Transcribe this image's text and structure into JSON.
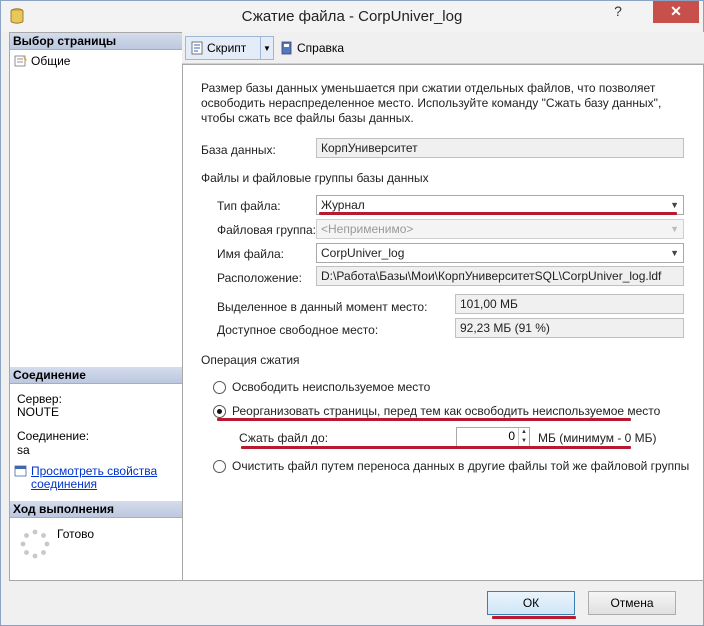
{
  "window": {
    "title": "Сжатие файла - CorpUniver_log",
    "help_label": "?",
    "close_label": "✕"
  },
  "left": {
    "select_page_header": "Выбор страницы",
    "pages": [
      {
        "label": "Общие",
        "icon": "settings-page-icon"
      }
    ],
    "connection_header": "Соединение",
    "server_label": "Сервер:",
    "server_value": "NOUTE",
    "connection_label": "Соединение:",
    "connection_value": "sa",
    "view_props_link": "Просмотреть свойства соединения",
    "progress_header": "Ход выполнения",
    "progress_status": "Готово"
  },
  "toolbar": {
    "script_label": "Скрипт",
    "help_label": "Справка"
  },
  "main": {
    "description": "Размер базы данных уменьшается при сжатии отдельных файлов, что позволяет освободить нераспределенное место. Используйте команду \"Сжать базу данных\", чтобы сжать все файлы базы данных.",
    "database_label": "База данных:",
    "database_value": "КорпУниверситет",
    "files_group_label": "Файлы и файловые группы базы данных",
    "file_type_label": "Тип файла:",
    "file_type_value": "Журнал",
    "filegroup_label": "Файловая группа:",
    "filegroup_value": "<Неприменимо>",
    "file_name_label": "Имя файла:",
    "file_name_value": "CorpUniver_log",
    "location_label": "Расположение:",
    "location_value": "D:\\Работа\\Базы\\Мои\\КорпУниверситетSQL\\CorpUniver_log.ldf",
    "allocated_label": "Выделенное в данный момент место:",
    "allocated_value": "101,00 МБ",
    "free_label": "Доступное свободное место:",
    "free_value": "92,23 МБ (91 %)",
    "shrink_op_label": "Операция сжатия",
    "option_release": "Освободить неиспользуемое место",
    "option_reorganize": "Реорганизовать страницы, перед тем как освободить неиспользуемое место",
    "shrink_to_label": "Сжать файл до:",
    "shrink_to_value": "0",
    "shrink_to_unit": "МБ (минимум - 0 МБ)",
    "option_empty": "Очистить файл путем переноса данных в другие файлы той же файловой группы",
    "selected_option": "reorganize"
  },
  "buttons": {
    "ok": "ОК",
    "cancel": "Отмена"
  },
  "colors": {
    "annotation_underline": "#b81830",
    "link": "#0033cc",
    "section_header": "#c9d3e8"
  }
}
